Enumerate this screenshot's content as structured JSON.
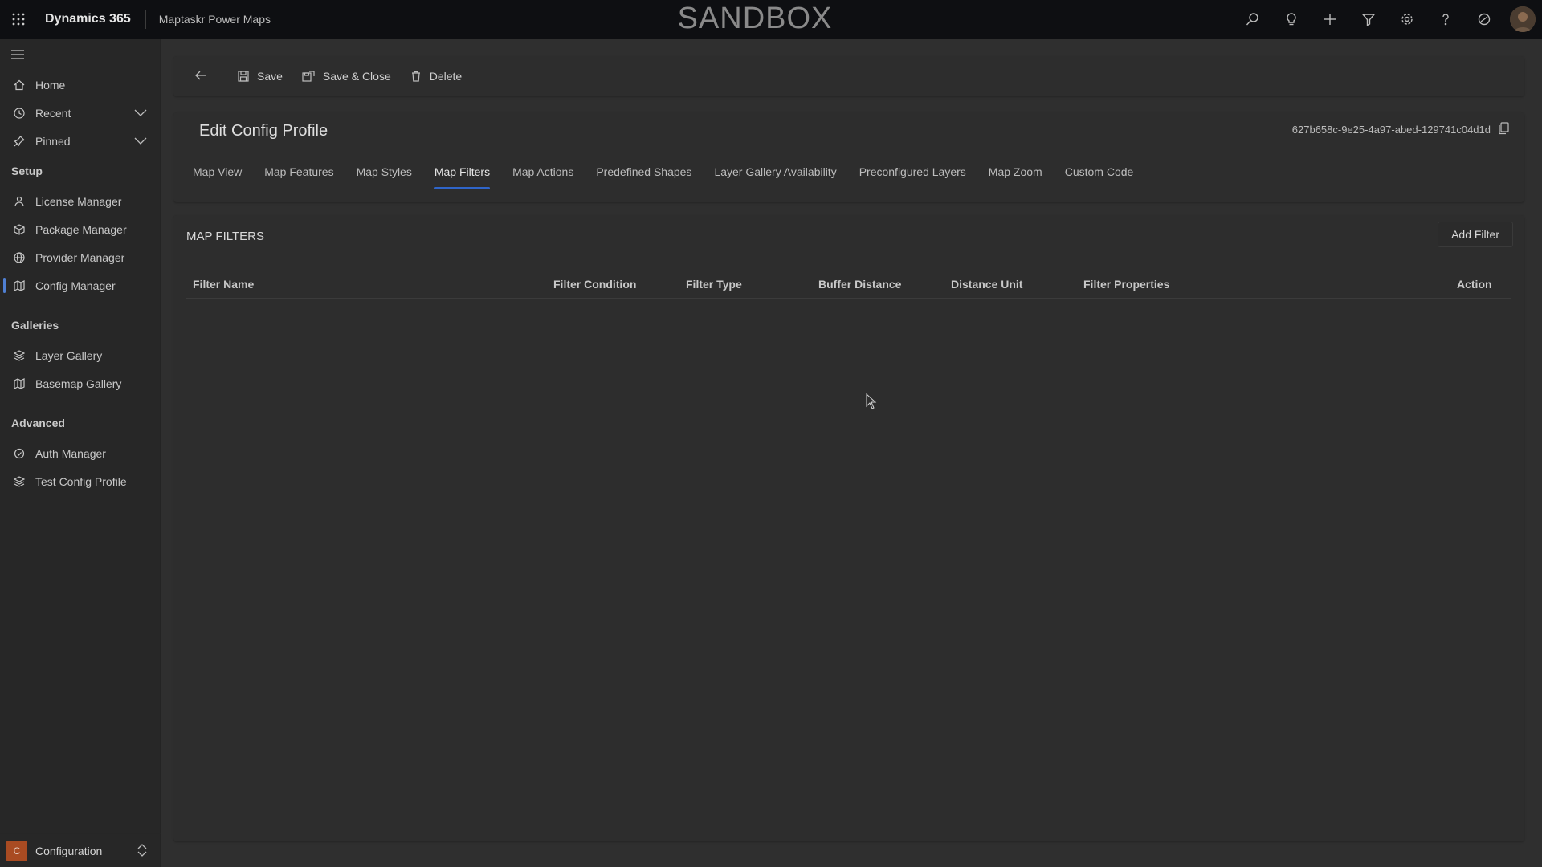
{
  "topbar": {
    "app_name": "Dynamics 365",
    "module_name": "Maptaskr Power Maps",
    "environment_banner": "SANDBOX",
    "icons": [
      "search-icon",
      "lightbulb-icon",
      "plus-icon",
      "filter-icon",
      "gear-icon",
      "help-icon",
      "copilot-icon"
    ]
  },
  "sidebar": {
    "top_items": [
      {
        "label": "Home",
        "icon": "home-icon"
      },
      {
        "label": "Recent",
        "icon": "clock-icon",
        "expandable": true
      },
      {
        "label": "Pinned",
        "icon": "pin-icon",
        "expandable": true
      }
    ],
    "sections": [
      {
        "title": "Setup",
        "items": [
          {
            "label": "License Manager",
            "icon": "license-icon"
          },
          {
            "label": "Package Manager",
            "icon": "package-icon"
          },
          {
            "label": "Provider Manager",
            "icon": "globe-icon"
          },
          {
            "label": "Config Manager",
            "icon": "map-icon",
            "active": true
          }
        ]
      },
      {
        "title": "Galleries",
        "items": [
          {
            "label": "Layer Gallery",
            "icon": "layers-icon"
          },
          {
            "label": "Basemap Gallery",
            "icon": "map-icon"
          }
        ]
      },
      {
        "title": "Advanced",
        "items": [
          {
            "label": "Auth Manager",
            "icon": "auth-icon"
          },
          {
            "label": "Test Config Profile",
            "icon": "layers-icon"
          }
        ]
      }
    ],
    "area": {
      "badge": "C",
      "label": "Configuration"
    }
  },
  "command_bar": {
    "save": "Save",
    "save_close": "Save & Close",
    "delete": "Delete"
  },
  "record": {
    "title": "Edit Config Profile",
    "id": "627b658c-9e25-4a97-abed-129741c04d1d"
  },
  "tabs": [
    {
      "label": "Map View"
    },
    {
      "label": "Map Features"
    },
    {
      "label": "Map Styles"
    },
    {
      "label": "Map Filters",
      "active": true
    },
    {
      "label": "Map Actions"
    },
    {
      "label": "Predefined Shapes"
    },
    {
      "label": "Layer Gallery Availability"
    },
    {
      "label": "Preconfigured Layers"
    },
    {
      "label": "Map Zoom"
    },
    {
      "label": "Custom Code"
    }
  ],
  "filters_section": {
    "title": "MAP FILTERS",
    "add_button": "Add Filter",
    "columns": [
      "Filter Name",
      "Filter Condition",
      "Filter Type",
      "Buffer Distance",
      "Distance Unit",
      "Filter Properties",
      "Action"
    ],
    "rows": []
  },
  "colors": {
    "topbar_bg": "#0e0f12",
    "page_bg": "#2f2f2f",
    "accent": "#2f65c9",
    "area_badge": "#a94b22"
  }
}
